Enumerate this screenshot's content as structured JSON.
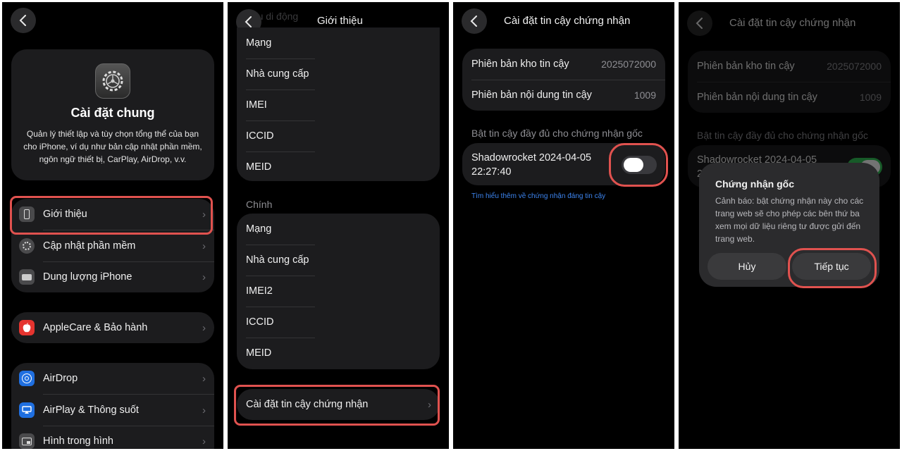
{
  "panel1": {
    "header": {
      "title": "Cài đặt chung",
      "description": "Quản lý thiết lập và tùy chọn tổng thể của bạn cho iPhone, ví dụ như bản cập nhật phần mềm, ngôn ngữ thiết bị, CarPlay, AirDrop, v.v."
    },
    "group1": [
      {
        "label": "Giới thiệu",
        "icon": "phone-icon"
      },
      {
        "label": "Cập nhật phần mềm",
        "icon": "gear-badge-icon"
      },
      {
        "label": "Dung lượng iPhone",
        "icon": "storage-icon"
      }
    ],
    "group2": [
      {
        "label": "AppleCare & Bảo hành",
        "icon": "apple-icon"
      }
    ],
    "group3": [
      {
        "label": "AirDrop",
        "icon": "airdrop-icon"
      },
      {
        "label": "AirPlay & Thông suốt",
        "icon": "airplay-icon"
      },
      {
        "label": "Hình trong hình",
        "icon": "pip-icon"
      }
    ]
  },
  "panel2": {
    "title": "Giới thiệu",
    "ghost_text": "...iệu di động",
    "group1": [
      "Mạng",
      "Nhà cung cấp",
      "IMEI",
      "ICCID",
      "MEID"
    ],
    "section_label": "Chính",
    "group2": [
      "Mạng",
      "Nhà cung cấp",
      "IMEI2",
      "ICCID",
      "MEID"
    ],
    "cert_row": "Cài đặt tin cậy chứng nhận"
  },
  "panel3": {
    "title": "Cài đặt tin cậy chứng nhận",
    "store_version_label": "Phiên bản kho tin cậy",
    "store_version_value": "2025072000",
    "asset_version_label": "Phiên bản nội dung tin cậy",
    "asset_version_value": "1009",
    "section_label": "Bật tin cậy đầy đủ cho chứng nhận gốc",
    "cert_name_line1": "Shadowrocket 2024-04-05",
    "cert_name_line2": "22:27:40",
    "toggle_state": "on",
    "learn_more": "Tìm hiểu thêm về chứng nhận đáng tin cậy"
  },
  "panel4": {
    "title": "Cài đặt tin cậy chứng nhận",
    "store_version_label": "Phiên bản kho tin cậy",
    "store_version_value": "2025072000",
    "asset_version_label": "Phiên bản nội dung tin cậy",
    "asset_version_value": "1009",
    "section_label": "Bật tin cậy đầy đủ cho chứng nhận gốc",
    "cert_name_line1": "Shadowrocket 2024-04-05",
    "cert_name_line2": "2",
    "alert": {
      "title": "Chứng nhận gốc",
      "body": "Cảnh báo: bật chứng nhận này cho các trang web sẽ cho phép các bên thứ ba xem mọi dữ liệu riêng tư được gửi đến trang web.",
      "cancel": "Hủy",
      "continue": "Tiếp tục"
    }
  },
  "colors": {
    "highlight": "#e0524f",
    "card": "#1c1c1e",
    "link": "#3d85f0",
    "toggle_on": "#34c759"
  }
}
